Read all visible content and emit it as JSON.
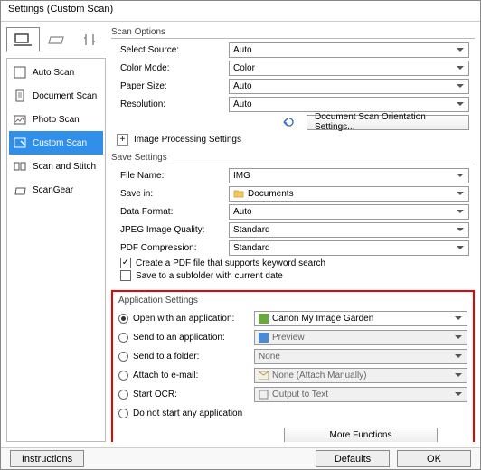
{
  "window": {
    "title": "Settings (Custom Scan)"
  },
  "sidebar": {
    "items": [
      {
        "label": "Auto Scan"
      },
      {
        "label": "Document Scan"
      },
      {
        "label": "Photo Scan"
      },
      {
        "label": "Custom Scan"
      },
      {
        "label": "Scan and Stitch"
      },
      {
        "label": "ScanGear"
      }
    ]
  },
  "scan_options": {
    "title": "Scan Options",
    "select_source": {
      "label": "Select Source:",
      "value": "Auto"
    },
    "color_mode": {
      "label": "Color Mode:",
      "value": "Color"
    },
    "paper_size": {
      "label": "Paper Size:",
      "value": "Auto"
    },
    "resolution": {
      "label": "Resolution:",
      "value": "Auto"
    },
    "orientation_btn": "Document Scan Orientation Settings...",
    "expander": "Image Processing Settings"
  },
  "save_settings": {
    "title": "Save Settings",
    "file_name": {
      "label": "File Name:",
      "value": "IMG"
    },
    "save_in": {
      "label": "Save in:",
      "value": "Documents"
    },
    "data_format": {
      "label": "Data Format:",
      "value": "Auto"
    },
    "jpeg_q": {
      "label": "JPEG Image Quality:",
      "value": "Standard"
    },
    "pdf_c": {
      "label": "PDF Compression:",
      "value": "Standard"
    },
    "cb_keyword": "Create a PDF file that supports keyword search",
    "cb_subfolder": "Save to a subfolder with current date"
  },
  "app_settings": {
    "title": "Application Settings",
    "open_app": {
      "label": "Open with an application:",
      "value": "Canon My Image Garden"
    },
    "send_app": {
      "label": "Send to an application:",
      "value": "Preview"
    },
    "send_folder": {
      "label": "Send to a folder:",
      "value": "None"
    },
    "attach": {
      "label": "Attach to e-mail:",
      "value": "None (Attach Manually)"
    },
    "ocr": {
      "label": "Start OCR:",
      "value": "Output to Text"
    },
    "none": {
      "label": "Do not start any application"
    },
    "more_btn": "More Functions"
  },
  "footer": {
    "instructions": "Instructions",
    "defaults": "Defaults",
    "ok": "OK"
  }
}
